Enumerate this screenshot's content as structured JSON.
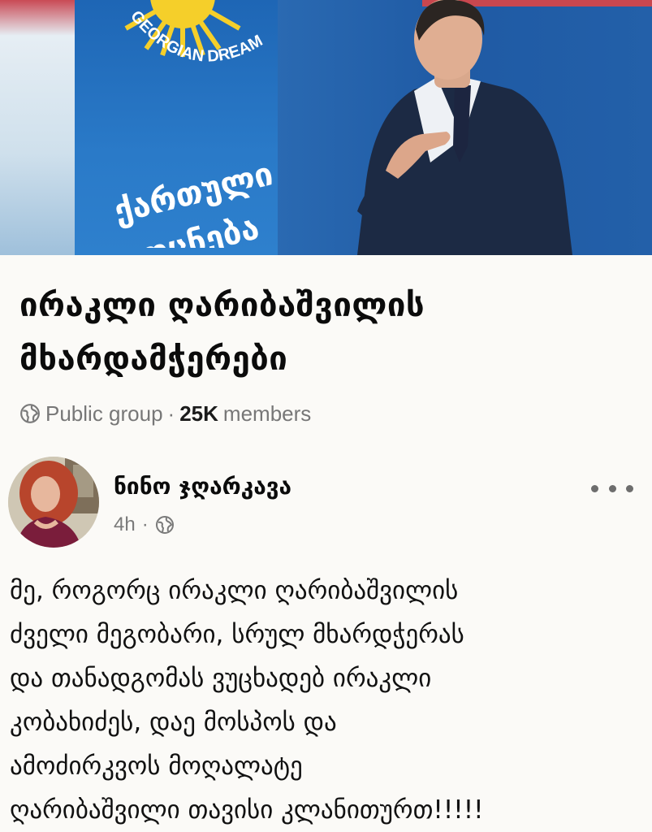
{
  "cover": {
    "banner_brand": "GEORGIAN DREAM",
    "banner_text_line1": "ქართული",
    "banner_text_line2": "ოცნება"
  },
  "group": {
    "title_line1": "ირაკლი ღარიბაშვილის",
    "title_line2": "მხარდამჭერები",
    "privacy": "Public group",
    "separator": "·",
    "member_count": "25K",
    "member_label": "members",
    "privacy_icon": "globe-icon"
  },
  "post": {
    "author": "ნინო ჯღარკავა",
    "time": "4h",
    "separator": "·",
    "audience_icon": "globe-icon",
    "menu_icon": "more-dots-icon",
    "body_lines": [
      "მე, როგორც ირაკლი ღარიბაშვილის",
      "ძველი მეგობარი, სრულ მხარდჭერას",
      "და თანადგომას ვუცხადებ ირაკლი",
      "კობახიძეს, დაე მოსპოს და",
      "ამოძირკვოს მოღალატე",
      "ღარიბაშვილი თავისი კლანითურთ!!!!!"
    ]
  }
}
